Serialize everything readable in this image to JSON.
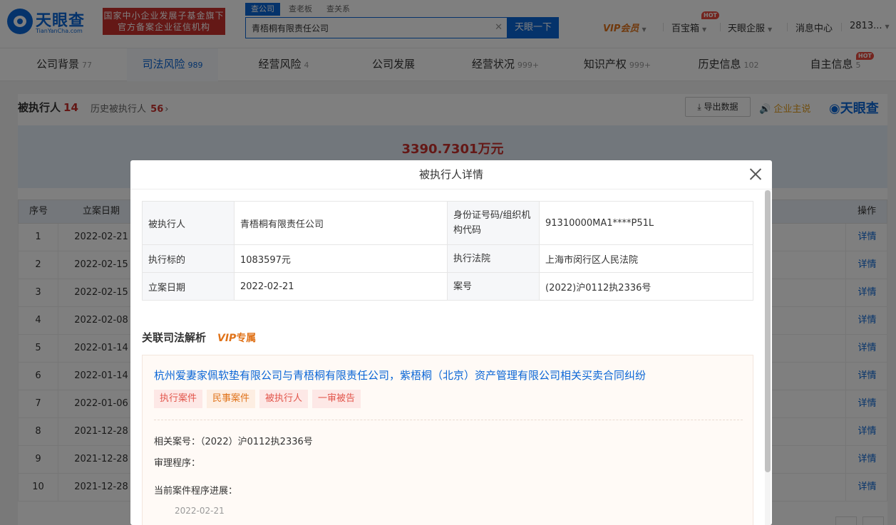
{
  "header": {
    "logo_name": "天眼查",
    "logo_domain": "TianYanCha.com",
    "slogan_line1": "国家中小企业发展子基金旗下",
    "slogan_line2": "官方备案企业征信机构",
    "search_tabs": [
      "查公司",
      "查老板",
      "查关系"
    ],
    "search_value": "青梧桐有限责任公司",
    "search_button": "天眼一下",
    "vip_label": "VIP会员",
    "nav_baobao": "百宝箱",
    "hot_badge": "HOT",
    "nav_enterprise": "天眼企服",
    "nav_messages": "消息中心",
    "nav_user": "2813..."
  },
  "company_tabs": [
    {
      "label": "公司背景",
      "count": "77"
    },
    {
      "label": "司法风险",
      "count": "989"
    },
    {
      "label": "经营风险",
      "count": "4"
    },
    {
      "label": "公司发展",
      "count": ""
    },
    {
      "label": "经营状况",
      "count": "999+"
    },
    {
      "label": "知识产权",
      "count": "999+"
    },
    {
      "label": "历史信息",
      "count": "102"
    },
    {
      "label": "自主信息",
      "count": "5"
    }
  ],
  "section": {
    "title": "被执行人",
    "count": "14",
    "history_label": "历史被执行人",
    "history_count": "56",
    "export_label": "导出数据",
    "enterprise_say": "企业主说",
    "brand": "天眼查",
    "total_amount": "3390.7301万元"
  },
  "table": {
    "col_index": "序号",
    "col_date": "立案日期",
    "col_action": "操作",
    "action_label": "详情",
    "rows": [
      {
        "index": "1",
        "date": "2022-02-21"
      },
      {
        "index": "2",
        "date": "2022-02-15"
      },
      {
        "index": "3",
        "date": "2022-02-15"
      },
      {
        "index": "4",
        "date": "2022-02-08"
      },
      {
        "index": "5",
        "date": "2022-01-14"
      },
      {
        "index": "6",
        "date": "2022-01-14"
      },
      {
        "index": "7",
        "date": "2022-01-06"
      },
      {
        "index": "8",
        "date": "2021-12-28"
      },
      {
        "index": "9",
        "date": "2021-12-28"
      },
      {
        "index": "10",
        "date": "2021-12-28"
      }
    ]
  },
  "modal": {
    "title": "被执行人详情",
    "fields": {
      "executed_person_label": "被执行人",
      "executed_person": "青梧桐有限责任公司",
      "id_code_label": "身份证号码/组织机构代码",
      "id_code": "91310000MA1****P51L",
      "target_label": "执行标的",
      "target": "1083597元",
      "court_label": "执行法院",
      "court": "上海市闵行区人民法院",
      "filing_date_label": "立案日期",
      "filing_date": "2022-02-21",
      "case_no_label": "案号",
      "case_no": "(2022)沪0112执2336号"
    },
    "related_title": "关联司法解析",
    "related_vip": "VIP",
    "related_vip_suffix": "专属",
    "case": {
      "title": "杭州爱妻家佩软垫有限公司与青梧桐有限责任公司，紫梧桐（北京）资产管理有限公司相关买卖合同纠纷",
      "tags": [
        "执行案件",
        "民事案件",
        "被执行人",
        "一审被告"
      ],
      "related_case_no": "相关案号：（2022）沪0112执2336号",
      "trial_procedure": "审理程序：",
      "progress_label": "当前案件程序进展：",
      "progress_date": "2022-02-21"
    }
  }
}
